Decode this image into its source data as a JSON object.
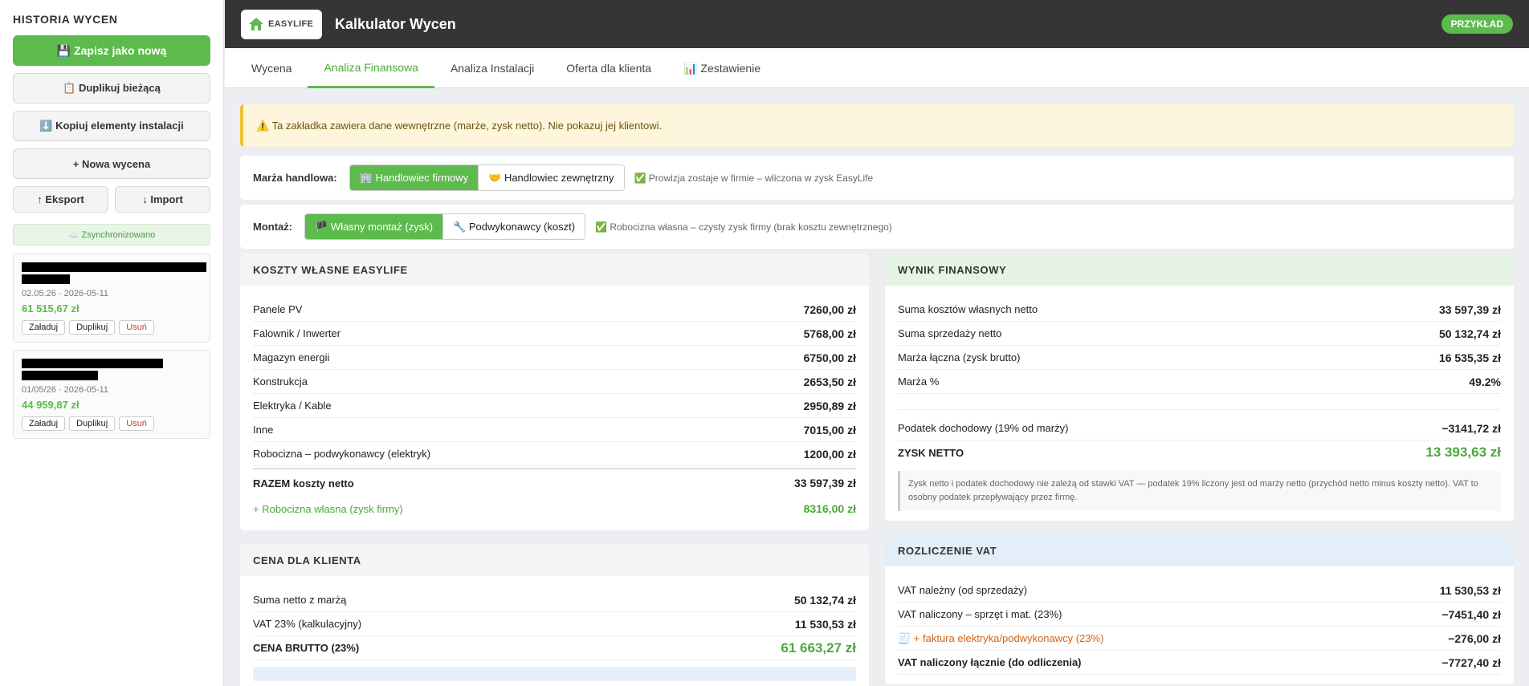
{
  "sidebar": {
    "title": "HISTORIA WYCEN",
    "save_new": "💾 Zapisz jako nową",
    "duplicate": "📋 Duplikuj bieżącą",
    "copy_elements": "⬇️ Kopiuj elementy instalacji",
    "new_quote": "+ Nowa wycena",
    "export": "↑ Eksport",
    "import": "↓ Import",
    "sync": "☁️ Zsynchronizowano",
    "history": [
      {
        "date": "02.05.26 · 2026-05-11",
        "amount": "61 515,67 zł",
        "load": "Załaduj",
        "dup": "Duplikuj",
        "del": "Usuń"
      },
      {
        "date": "01/05/26 · 2026-05-11",
        "amount": "44 959,87 zł",
        "load": "Załaduj",
        "dup": "Duplikuj",
        "del": "Usuń"
      }
    ]
  },
  "header": {
    "logo_text": "EASYLIFE",
    "title": "Kalkulator Wycen",
    "badge": "PRZYKŁAD"
  },
  "tabs": [
    "Wycena",
    "Analiza Finansowa",
    "Analiza Instalacji",
    "Oferta dla klienta",
    "📊 Zestawienie"
  ],
  "warning": "⚠️ Ta zakładka zawiera dane wewnętrzne (marże, zysk netto). Nie pokazuj jej klientowi.",
  "margin": {
    "label": "Marża handlowa:",
    "opt1": "🏢 Handlowiec firmowy",
    "opt2": "🤝 Handlowiec zewnętrzny",
    "note": "✅ Prowizja zostaje w firmie – wliczona w zysk EasyLife"
  },
  "mount": {
    "label": "Montaż:",
    "opt1": "🏴 Własny montaż (zysk)",
    "opt2": "🔧 Podwykonawcy (koszt)",
    "note": "✅ Robocizna własna – czysty zysk firmy (brak kosztu zewnętrznego)"
  },
  "costs": {
    "title": "KOSZTY WŁASNE EASYLIFE",
    "rows": [
      {
        "label": "Panele PV",
        "value": "7260,00 zł"
      },
      {
        "label": "Falownik / Inwerter",
        "value": "5768,00 zł"
      },
      {
        "label": "Magazyn energii",
        "value": "6750,00 zł"
      },
      {
        "label": "Konstrukcja",
        "value": "2653,50 zł"
      },
      {
        "label": "Elektryka / Kable",
        "value": "2950,89 zł"
      },
      {
        "label": "Inne",
        "value": "7015,00 zł"
      },
      {
        "label": "Robocizna – podwykonawcy (elektryk)",
        "value": "1200,00 zł"
      }
    ],
    "total_label": "RAZEM koszty netto",
    "total_value": "33 597,39 zł",
    "own_label": "+ Robocizna własna (zysk firmy)",
    "own_value": "8316,00 zł"
  },
  "client_price": {
    "title": "CENA DLA KLIENTA",
    "r1_label": "Suma netto z marżą",
    "r1_value": "50 132,74 zł",
    "r2_label": "VAT 23% (kalkulacyjny)",
    "r2_value": "11 530,53 zł",
    "r3_label": "CENA BRUTTO (23%)",
    "r3_value": "61 663,27 zł"
  },
  "result": {
    "title": "WYNIK FINANSOWY",
    "r1_label": "Suma kosztów własnych netto",
    "r1_value": "33 597,39 zł",
    "r2_label": "Suma sprzedaży netto",
    "r2_value": "50 132,74 zł",
    "r3_label": "Marża łączna (zysk brutto)",
    "r3_value": "16 535,35 zł",
    "r4_label": "Marża %",
    "r4_value": "49.2%",
    "r5_label": "Podatek dochodowy (19% od marży)",
    "r5_value": "−3141,72 zł",
    "r6_label": "ZYSK NETTO",
    "r6_value": "13 393,63 zł",
    "note": "Zysk netto i podatek dochodowy nie zależą od stawki VAT — podatek 19% liczony jest od marży netto (przychód netto minus koszty netto). VAT to osobny podatek przepływający przez firmę."
  },
  "vat": {
    "title": "ROZLICZENIE VAT",
    "r1_label": "VAT należny (od sprzedaży)",
    "r1_value": "11 530,53 zł",
    "r2_label": "VAT naliczony – sprzęt i mat. (23%)",
    "r2_value": "−7451,40 zł",
    "r3_label": "🧾 + faktura elektryka/podwykonawcy (23%)",
    "r3_value": "−276,00 zł",
    "r4_label": "VAT naliczony łącznie (do odliczenia)",
    "r4_value": "−7727,40 zł"
  }
}
